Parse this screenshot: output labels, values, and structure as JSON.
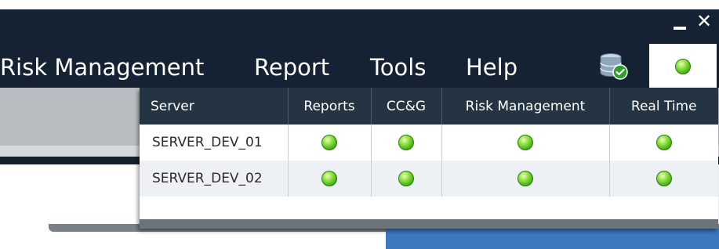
{
  "window": {
    "minimize_icon": "minimize-icon",
    "close_glyph": "✕"
  },
  "menu": {
    "items": [
      "Risk Management",
      "Report",
      "Tools",
      "Help"
    ]
  },
  "toolbar": {
    "db_icon": "database-check-icon",
    "status_icon": "green-status-icon"
  },
  "status_popup": {
    "columns": [
      "Server",
      "Reports",
      "CC&G",
      "Risk Management",
      "Real Time"
    ],
    "rows": [
      {
        "server": "SERVER_DEV_01",
        "reports": "green",
        "ccg": "green",
        "risk_management": "green",
        "real_time": "green"
      },
      {
        "server": "SERVER_DEV_02",
        "reports": "green",
        "ccg": "green",
        "risk_management": "green",
        "real_time": "green"
      }
    ]
  },
  "colors": {
    "menubar": "#152233",
    "header": "#253443",
    "status_green": "#39a813",
    "accent_blue": "#3b78be"
  }
}
